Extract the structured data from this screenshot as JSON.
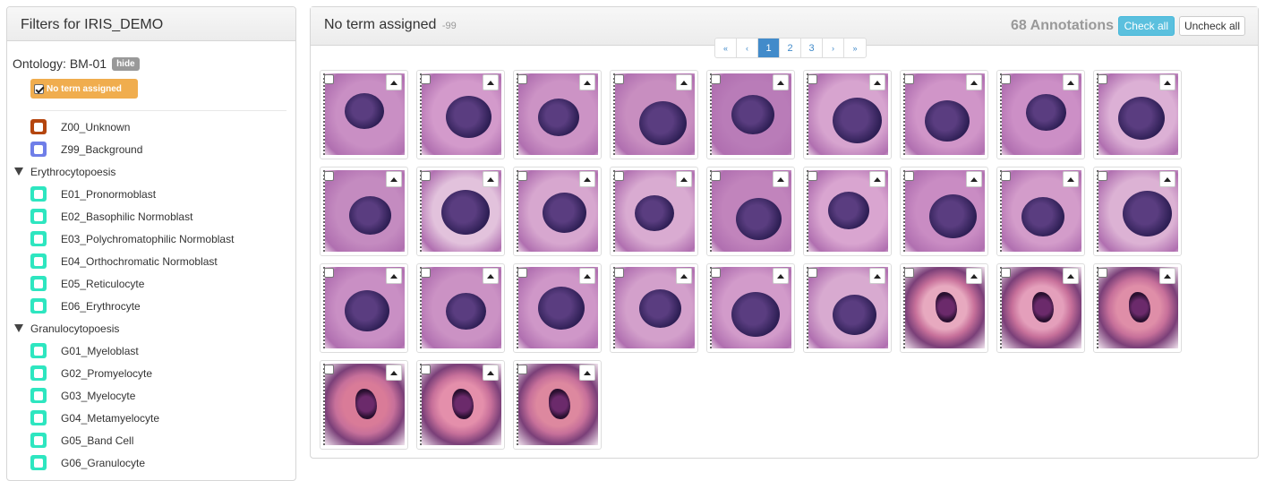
{
  "left": {
    "title": "Filters for IRIS_DEMO",
    "ontology_label": "Ontology: BM-01",
    "hide_label": "hide",
    "no_term_label": "No term assigned",
    "terms": [
      {
        "kind": "leaf",
        "label": "Z00_Unknown",
        "color": "#b5460f"
      },
      {
        "kind": "leaf",
        "label": "Z99_Background",
        "color": "#6f7ee8"
      },
      {
        "kind": "group",
        "label": "Erythrocytopoesis"
      },
      {
        "kind": "leaf",
        "label": "E01_Pronormoblast",
        "color": "#2ee6c0"
      },
      {
        "kind": "leaf",
        "label": "E02_Basophilic Normoblast",
        "color": "#2ee6c0"
      },
      {
        "kind": "leaf",
        "label": "E03_Polychromatophilic Normoblast",
        "color": "#2ee6c0"
      },
      {
        "kind": "leaf",
        "label": "E04_Orthochromatic Normoblast",
        "color": "#2ee6c0"
      },
      {
        "kind": "leaf",
        "label": "E05_Reticulocyte",
        "color": "#2ee6c0"
      },
      {
        "kind": "leaf",
        "label": "E06_Erythrocyte",
        "color": "#2ee6c0"
      },
      {
        "kind": "group",
        "label": "Granulocytopoesis"
      },
      {
        "kind": "leaf",
        "label": "G01_Myeloblast",
        "color": "#2ee6c0"
      },
      {
        "kind": "leaf",
        "label": "G02_Promyelocyte",
        "color": "#2ee6c0"
      },
      {
        "kind": "leaf",
        "label": "G03_Myelocyte",
        "color": "#2ee6c0"
      },
      {
        "kind": "leaf",
        "label": "G04_Metamyelocyte",
        "color": "#2ee6c0"
      },
      {
        "kind": "leaf",
        "label": "G05_Band Cell",
        "color": "#2ee6c0"
      },
      {
        "kind": "leaf",
        "label": "G06_Granulocyte",
        "color": "#2ee6c0"
      }
    ]
  },
  "main": {
    "title": "No term assigned",
    "title_count": "-99",
    "annotation_count": "68 Annotations",
    "check_all_label": "Check all",
    "uncheck_all_label": "Uncheck all",
    "pagination": [
      "«",
      "‹",
      "1",
      "2",
      "3",
      "›",
      "»"
    ],
    "active_page": "1",
    "thumbnails": [
      {
        "type": "small",
        "bg": "#c98fc4"
      },
      {
        "type": "small",
        "bg": "#d39acb"
      },
      {
        "type": "small",
        "bg": "#cc93c5"
      },
      {
        "type": "small",
        "bg": "#c88ec0"
      },
      {
        "type": "small",
        "bg": "#b97cb8"
      },
      {
        "type": "small",
        "bg": "#d7a4cf"
      },
      {
        "type": "small",
        "bg": "#d095c8"
      },
      {
        "type": "small",
        "bg": "#cc8fc6"
      },
      {
        "type": "small",
        "bg": "#dcb0d5"
      },
      {
        "type": "small",
        "bg": "#c48bc0"
      },
      {
        "type": "small",
        "bg": "#e2c2dc"
      },
      {
        "type": "small",
        "bg": "#d7a7cf"
      },
      {
        "type": "small",
        "bg": "#d9abd1"
      },
      {
        "type": "small",
        "bg": "#c184bc"
      },
      {
        "type": "small",
        "bg": "#d9a5d0"
      },
      {
        "type": "small",
        "bg": "#c98cc3"
      },
      {
        "type": "small",
        "bg": "#d39cca"
      },
      {
        "type": "small",
        "bg": "#dcb2d4"
      },
      {
        "type": "small",
        "bg": "#c98fc4"
      },
      {
        "type": "small",
        "bg": "#cb92c4"
      },
      {
        "type": "small",
        "bg": "#cf97c8"
      },
      {
        "type": "small",
        "bg": "#d3a0cb"
      },
      {
        "type": "small",
        "bg": "#d29bca"
      },
      {
        "type": "small",
        "bg": "#d8aad0"
      },
      {
        "type": "mega",
        "bg": "#e7a9bf"
      },
      {
        "type": "mega",
        "bg": "#e49fbb"
      },
      {
        "type": "mega",
        "bg": "#df8ea8"
      },
      {
        "type": "mega",
        "bg": "#d97b98"
      },
      {
        "type": "mega",
        "bg": "#e48fab"
      },
      {
        "type": "mega",
        "bg": "#dd889f"
      }
    ]
  }
}
